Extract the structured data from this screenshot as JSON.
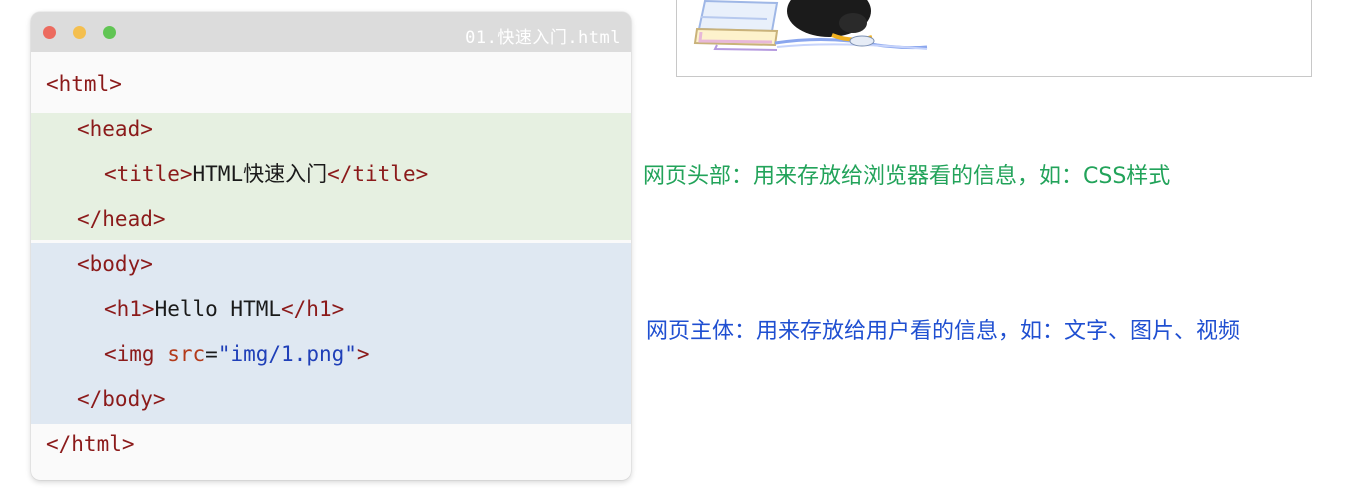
{
  "window": {
    "filename": "01.快速入门.html"
  },
  "code": {
    "line1": "<html>",
    "line2": "<head>",
    "line3_open": "<title>",
    "line3_text": "HTML快速入门",
    "line3_close": "</title>",
    "line4": "</head>",
    "line5": "<body>",
    "line6_open": "<h1>",
    "line6_text": "Hello HTML",
    "line6_close": "</h1>",
    "line7_open": "<img ",
    "line7_attr": "src",
    "line7_eq": "=",
    "line7_value": "\"img/1.png\"",
    "line7_close": ">",
    "line8": "</body>",
    "line9": "</html>"
  },
  "annotations": {
    "head": "网页头部：用来存放给浏览器看的信息，如：CSS样式",
    "body": "网页主体：用来存放给用户看的信息，如：文字、图片、视频"
  },
  "colors": {
    "head_band": "#e6f0e1",
    "body_band": "#dfe8f2",
    "head_note": "#22a35a",
    "body_note": "#1f4fd1"
  }
}
